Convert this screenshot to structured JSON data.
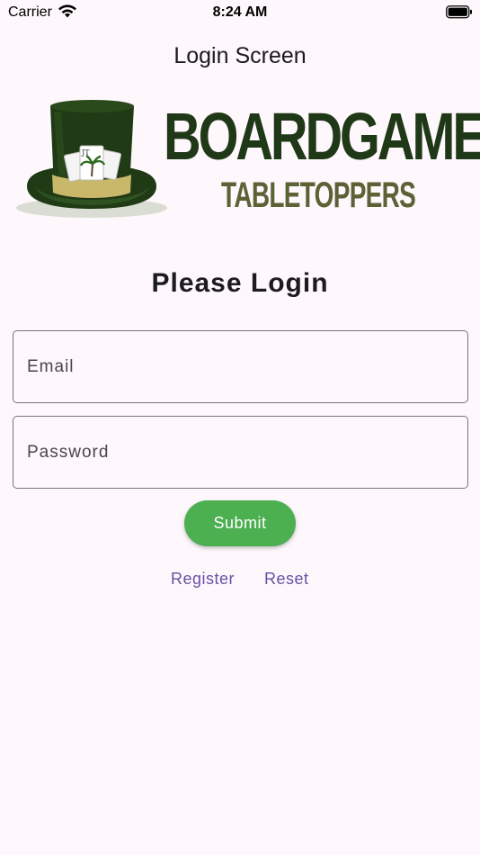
{
  "status_bar": {
    "carrier": "Carrier",
    "time": "8:24 AM"
  },
  "header": {
    "title": "Login Screen"
  },
  "logo": {
    "line1": "BOARDGAME",
    "line2": "TABLETOPPERS"
  },
  "form": {
    "title": "Please Login",
    "email_placeholder": "Email",
    "email_value": "",
    "password_placeholder": "Password",
    "password_value": "",
    "submit_label": "Submit"
  },
  "links": {
    "register": "Register",
    "reset": "Reset"
  },
  "colors": {
    "background": "#fef7fb",
    "accent_button": "#4caf50",
    "link": "#6750a4",
    "logo_dark_green": "#1f3817",
    "logo_olive": "#5b6236",
    "hat_band": "#c9b76a"
  },
  "icons": [
    "wifi-icon",
    "battery-icon",
    "top-hat-logo-icon"
  ]
}
